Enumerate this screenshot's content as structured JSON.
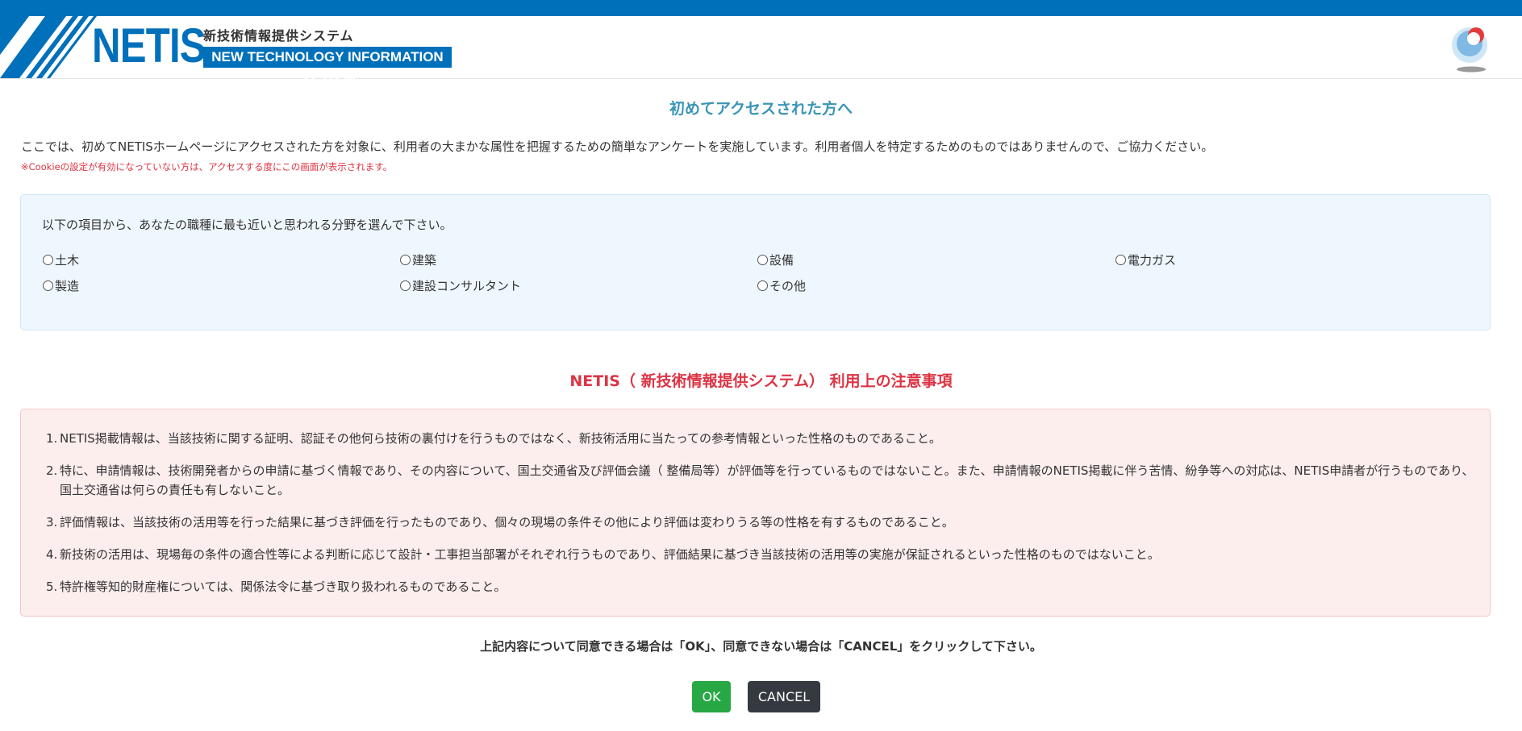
{
  "header": {
    "logo_text": "NETIS",
    "logo_jp": "新技術情報提供システム",
    "logo_en": "NEW TECHNOLOGY INFORMATION SYSTEM",
    "brand_color": "#0070bb",
    "emblem_icon": "mlit-emblem-icon"
  },
  "welcome": {
    "title": "初めてアクセスされた方へ",
    "intro": "ここでは、初めてNETISホームページにアクセスされた方を対象に、利用者の大まかな属性を把握するための簡単なアンケートを実施しています。利用者個人を特定するためのものではありませんので、ご協力ください。",
    "cookie_note": "※Cookieの設定が有効になっていない方は、アクセスする度にこの画面が表示されます。"
  },
  "survey": {
    "question": "以下の項目から、あなたの職種に最も近いと思われる分野を選んで下さい。",
    "options": [
      "土木",
      "建築",
      "設備",
      "電力ガス",
      "製造",
      "建設コンサルタント",
      "その他"
    ]
  },
  "notice": {
    "title": "NETIS（ 新技術情報提供システム） 利用上の注意事項",
    "items": [
      {
        "num": "1.",
        "text": "NETIS掲載情報は、当該技術に関する証明、認証その他何ら技術の裏付けを行うものではなく、新技術活用に当たっての参考情報といった性格のものであること。"
      },
      {
        "num": "2.",
        "text": "特に、申請情報は、技術開発者からの申請に基づく情報であり、その内容について、国土交通省及び評価会議（ 整備局等）が評価等を行っているものではないこと。また、申請情報のNETIS掲載に伴う苦情、紛争等への対応は、NETIS申請者が行うものであり、国土交通省は何らの責任も有しないこと。"
      },
      {
        "num": "3.",
        "text": "評価情報は、当該技術の活用等を行った結果に基づき評価を行ったものであり、個々の現場の条件その他により評価は変わりうる等の性格を有するものであること。"
      },
      {
        "num": "4.",
        "text": "新技術の活用は、現場毎の条件の適合性等による判断に応じて設計・工事担当部署がそれぞれ行うものであり、評価結果に基づき当該技術の活用等の実施が保証されるといった性格のものではないこと。"
      },
      {
        "num": "5.",
        "text": "特許権等知的財産権については、関係法令に基づき取り扱われるものであること。"
      }
    ]
  },
  "confirm": {
    "text": "上記内容について同意できる場合は「OK」、同意できない場合は「CANCEL」をクリックして下さい。",
    "ok_label": "OK",
    "cancel_label": "CANCEL",
    "ok_color": "#28a745",
    "cancel_color": "#343a40"
  }
}
